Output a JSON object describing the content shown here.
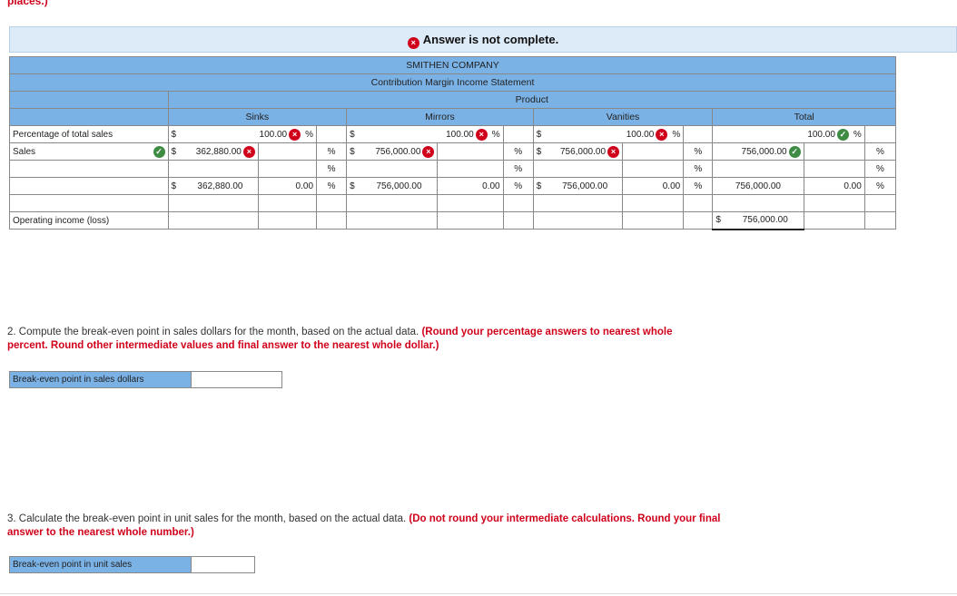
{
  "top_note": "places.)",
  "banner": {
    "text": "Answer is not complete."
  },
  "table": {
    "company": "SMITHEN COMPANY",
    "statement": "Contribution Margin Income Statement",
    "product_label": "Product",
    "columns": [
      "Sinks",
      "Mirrors",
      "Vanities",
      "Total"
    ],
    "row_labels": {
      "pct": "Percentage of total sales",
      "sales": "Sales",
      "op_income": "Operating income (loss)"
    },
    "symbols": {
      "dollar": "$",
      "pct": "%"
    },
    "pct_values": {
      "sinks": "100.00",
      "mirrors": "100.00",
      "vanities": "100.00",
      "total": "100.00"
    },
    "sales_values": {
      "sinks": "362,880.00",
      "mirrors": "756,000.00",
      "vanities": "756,000.00",
      "total": "756,000.00"
    },
    "cm_values": {
      "sinks": "362,880.00",
      "mirrors": "756,000.00",
      "vanities": "756,000.00",
      "total": "756,000.00"
    },
    "cm_pcts": {
      "sinks": "0.00",
      "mirrors": "0.00",
      "vanities": "0.00",
      "total": "0.00"
    },
    "op_income_total": "756,000.00"
  },
  "q2": {
    "lead": "2. Compute the break-even point in sales dollars for the month, based on the actual data. ",
    "instr": "(Round your percentage answers to nearest whole percent. Round other intermediate values and final answer to the nearest whole dollar.)",
    "label": "Break-even point in sales dollars",
    "value": ""
  },
  "q3": {
    "lead": "3. Calculate the break-even point in unit sales for the month, based on the actual data. ",
    "instr": "(Do not round your intermediate calculations. Round your final answer to the nearest whole number.)",
    "label": "Break-even point in unit sales",
    "value": ""
  },
  "icons": {
    "wrong": "×",
    "right": "✓"
  },
  "colors": {
    "header_blue": "#7bb2e6",
    "banner_bg": "#ddeaf8",
    "error_red": "#d0021b",
    "ok_green": "#3e8b43"
  }
}
